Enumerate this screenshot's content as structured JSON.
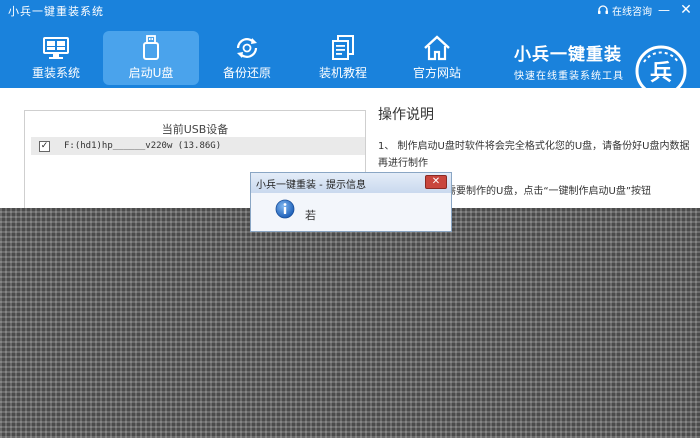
{
  "window": {
    "title": "小兵一键重装系统",
    "online_consult": "在线咨询",
    "min_glyph": "—",
    "close_glyph": "✕"
  },
  "nav": {
    "items": [
      {
        "label": "重装系统",
        "icon": "monitor-icon"
      },
      {
        "label": "启动U盘",
        "icon": "usb-icon",
        "active": true
      },
      {
        "label": "备份还原",
        "icon": "backup-icon"
      },
      {
        "label": "装机教程",
        "icon": "document-icon"
      },
      {
        "label": "官方网站",
        "icon": "home-icon"
      }
    ]
  },
  "brand": {
    "title": "小兵一键重装",
    "slogan": "快速在线重装系统工具",
    "logo_mark": "兵"
  },
  "usb_panel": {
    "title": "当前USB设备",
    "device": "F:(hd1)hp______v220w (13.86G)",
    "checked_glyph": "✓"
  },
  "help": {
    "title": "操作说明",
    "lines": [
      "1、 制作启动U盘时软件将会完全格式化您的U盘，请备份好U盘内数据",
      "再进行制作",
      "需要制作的U盘，点击“一键制作启动U盘”按钮"
    ]
  },
  "dialog": {
    "title": "小兵一键重装 - 提示信息",
    "close_glyph": "✕",
    "message_fragment": "若"
  },
  "colors": {
    "primary": "#1a82dc",
    "nav_active": "#4aa3ec",
    "dialog_close": "#c9463d"
  }
}
